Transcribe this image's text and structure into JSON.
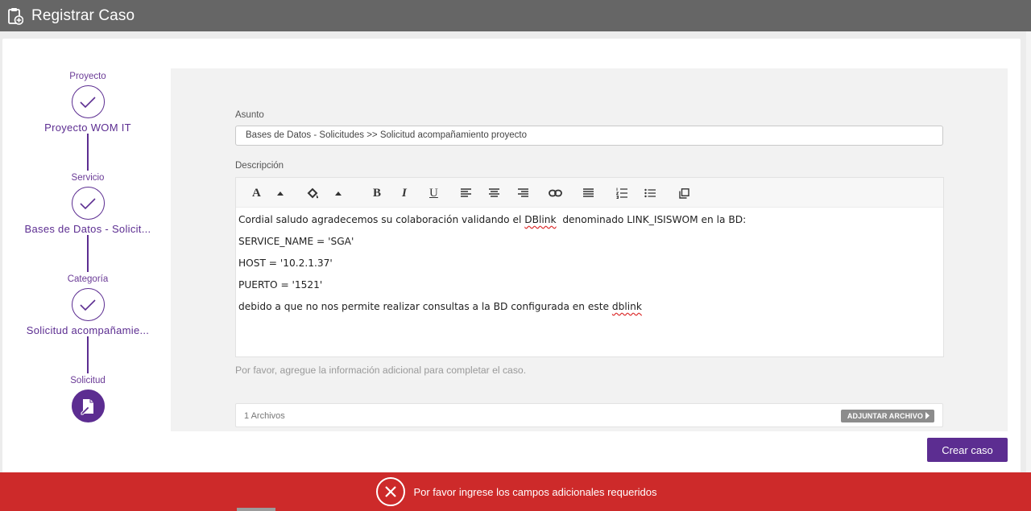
{
  "header": {
    "title": "Registrar Caso",
    "icon": "clipboard-add-icon",
    "bg_color": "#666666"
  },
  "stepper": {
    "steps": [
      {
        "label": "Proyecto",
        "value": "Proyecto WOM IT",
        "state": "done"
      },
      {
        "label": "Servicio",
        "value": "Bases de Datos - Solicit...",
        "state": "done"
      },
      {
        "label": "Categoría",
        "value": "Solicitud acompañamie...",
        "state": "done"
      },
      {
        "label": "Solicitud",
        "value": "",
        "state": "active"
      }
    ],
    "accent_color": "#5c2d91"
  },
  "form": {
    "subject_label": "Asunto",
    "subject_value": "Bases de Datos - Solicitudes >> Solicitud acompañamiento proyecto",
    "description_label": "Descripción",
    "toolbar": {
      "font_color_label": "A",
      "bold_label": "B",
      "italic_label": "I",
      "underline_label": "U",
      "icons": [
        "font-color-icon",
        "fill-color-icon",
        "bold-icon",
        "italic-icon",
        "underline-icon",
        "align-left-icon",
        "align-center-icon",
        "align-right-icon",
        "link-icon",
        "justify-icon",
        "ordered-list-icon",
        "unordered-list-icon",
        "copy-icon"
      ]
    },
    "description": {
      "line1_pre": "Cordial saludo agradecemos su colaboración validando el ",
      "line1_spell": "DBlink",
      "line1_post": "  denominado LINK_ISISWOM en la BD:",
      "line2": "SERVICE_NAME = 'SGA'",
      "line3": "HOST = '10.2.1.37'",
      "line4": "PUERTO = '1521'",
      "line5_pre": "debido a que no nos permite realizar consultas a la BD configurada en este ",
      "line5_spell": "dblink"
    },
    "helper_text": "Por favor, agregue la información adicional para completar el caso.",
    "attachments_count": "1 Archivos",
    "attach_button": "ADJUNTAR ARCHIVO"
  },
  "create_button": "Crear caso",
  "error_banner": {
    "message": "Por favor ingrese los campos adicionales requeridos",
    "color": "#cd2a2a",
    "icon": "close-circle-icon"
  }
}
